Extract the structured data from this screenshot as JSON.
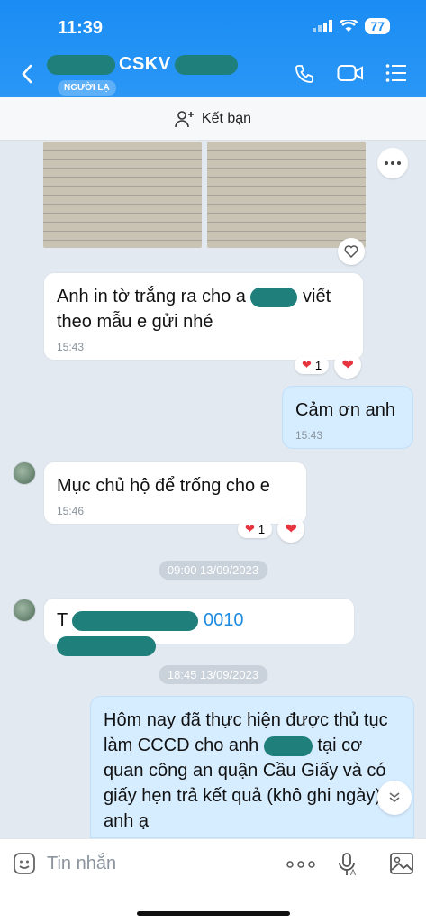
{
  "status": {
    "time": "11:39",
    "battery": "77"
  },
  "header": {
    "title": "CSKV",
    "badge": "NGƯỜI LẠ"
  },
  "add_friend": {
    "label": "Kết bạn"
  },
  "messages": [
    {
      "text_a": "Anh in tờ trắng ra cho a",
      "text_b": "viết theo mẫu e gửi nhé",
      "time": "15:43",
      "reaction_count": "1"
    },
    {
      "text": "Cảm ơn anh",
      "time": "15:43"
    },
    {
      "text": "Mục chủ hộ để trống cho e",
      "time": "15:46",
      "reaction_count": "1"
    },
    {
      "prefix": "T",
      "link_text": "0010"
    },
    {
      "text_a": "Hôm nay đã thực hiện được thủ tục làm CCCD cho anh",
      "text_b": "tại cơ quan công an quận Cầu Giấy và có giấy hẹn trả kết quả (khô",
      "text_c": "ghi ngày), anh ạ"
    }
  ],
  "dates": {
    "d1": "09:00 13/09/2023",
    "d2": "18:45 13/09/2023"
  },
  "composer": {
    "placeholder": "Tin nhắn"
  },
  "colors": {
    "header": "#1a8cf4",
    "outgoing": "#d6ecff",
    "link": "#1f8be0",
    "redaction": "#1f7f7a"
  },
  "icons": [
    "back-arrow-icon",
    "phone-icon",
    "video-icon",
    "menu-icon",
    "add-user-icon",
    "more-icon",
    "heart-icon",
    "sticker-icon",
    "ellipsis-icon",
    "mic-icon",
    "image-icon",
    "chevron-down-icon"
  ]
}
